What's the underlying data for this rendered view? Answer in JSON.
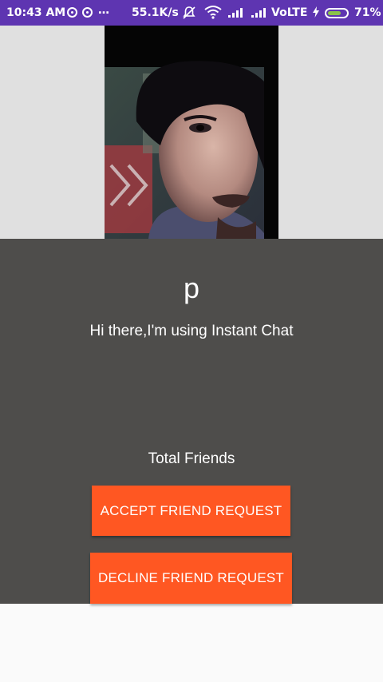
{
  "status_bar": {
    "time": "10:43 AM",
    "more": "…",
    "speed": "55.1K/s",
    "network": "VoLTE",
    "battery": "71%",
    "battery_level": 0.71,
    "color": "#5e35b1"
  },
  "profile": {
    "name": "p",
    "status": "Hi there,I'm using Instant Chat",
    "friends_label": "Total Friends"
  },
  "actions": {
    "accept_label": "ACCEPT FRIEND REQUEST",
    "decline_label": "DECLINE FRIEND REQUEST",
    "button_color": "#ff5722"
  },
  "icons": [
    "whatsapp-icon",
    "whatsapp-icon",
    "mute-icon",
    "wifi-icon",
    "signal-icon",
    "charging-icon",
    "battery-icon"
  ]
}
